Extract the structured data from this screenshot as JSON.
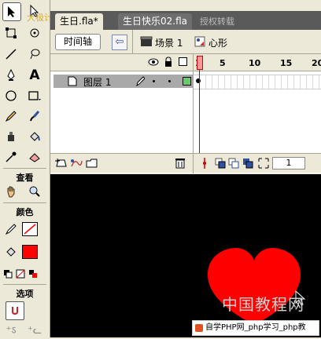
{
  "toolbox": {
    "sections": {
      "view": "查看",
      "colors": "颜色",
      "options": "选项"
    },
    "watermark": "大极计与联系 hotcoan"
  },
  "tabs": [
    {
      "label": "生日.fla*"
    },
    {
      "label": "生日快乐02.fla"
    }
  ],
  "tab_watermark": "授权转载",
  "scenebar": {
    "timeline_button": "时间轴",
    "scene_label": "场景 1",
    "symbol_label": "心形"
  },
  "timeline": {
    "layer_name": "图层 1",
    "ruler_ticks": [
      "1",
      "5",
      "10",
      "15",
      "20"
    ],
    "current_frame": "1"
  },
  "stage": {
    "watermark_big": "中国教程网",
    "watermark_link": "自学PHP网_php学习_php教"
  },
  "colors": {
    "stroke": "#000000",
    "fill": "#ff0000",
    "heart": "#ff0000"
  }
}
